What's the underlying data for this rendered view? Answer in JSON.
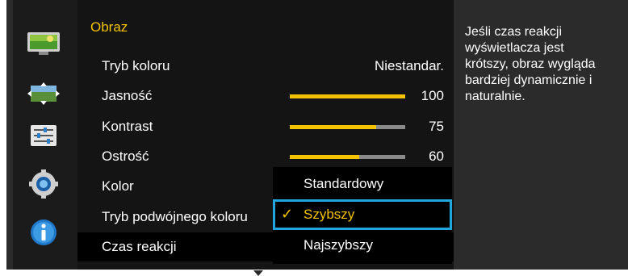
{
  "side_icons": [
    "picture-icon",
    "screen-adjust-icon",
    "settings-sliders-icon",
    "gear-icon",
    "info-icon"
  ],
  "menu": {
    "title": "Obraz",
    "rows": [
      {
        "label": "Tryb koloru",
        "value": "Niestandar."
      },
      {
        "label": "Jasność",
        "value": "100",
        "level": 1.0
      },
      {
        "label": "Kontrast",
        "value": "75",
        "level": 0.75
      },
      {
        "label": "Ostrość",
        "value": "60",
        "level": 0.6
      },
      {
        "label": "Kolor"
      },
      {
        "label": "Tryb podwójnego koloru"
      },
      {
        "label": "Czas reakcji"
      }
    ]
  },
  "submenu": {
    "options": [
      "Standardowy",
      "Szybszy",
      "Najszybszy"
    ],
    "check_mark": "✓"
  },
  "info": {
    "text": "Jeśli czas reakcji wyświetlacza jest krótszy, obraz wygląda bardziej dynamicznie i naturalnie."
  },
  "colors": {
    "accent": "#f3c200",
    "focus": "#21a7de"
  }
}
